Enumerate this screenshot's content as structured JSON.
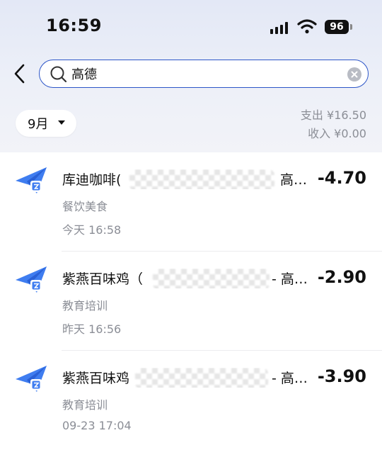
{
  "status_bar": {
    "time": "16:59",
    "battery": "96"
  },
  "search": {
    "value": "高德"
  },
  "filter": {
    "month": "9月"
  },
  "summary": {
    "expense": "支出 ¥16.50",
    "income": "收入 ¥0.00"
  },
  "transactions": [
    {
      "title_prefix": "库迪咖啡(",
      "title_suffix": "高…",
      "amount": "-4.70",
      "category": "餐饮美食",
      "time": "今天 16:58"
    },
    {
      "title_prefix": "紫燕百味鸡（",
      "title_suffix": "- 高…",
      "amount": "-2.90",
      "category": "教育培训",
      "time": "昨天 16:56"
    },
    {
      "title_prefix": "紫燕百味鸡",
      "title_suffix": "- 高…",
      "amount": "-3.90",
      "category": "教育培训",
      "time": "09-23 17:04"
    }
  ],
  "colors": {
    "accent": "#2d56c8",
    "app_icon": "#3f7df0",
    "secondary_text": "#8b8e96"
  },
  "icons": [
    "back-chevron-icon",
    "search-icon",
    "clear-icon",
    "caret-down-icon",
    "paper-plane-app-icon",
    "signal-icon",
    "wifi-icon",
    "battery-icon"
  ]
}
